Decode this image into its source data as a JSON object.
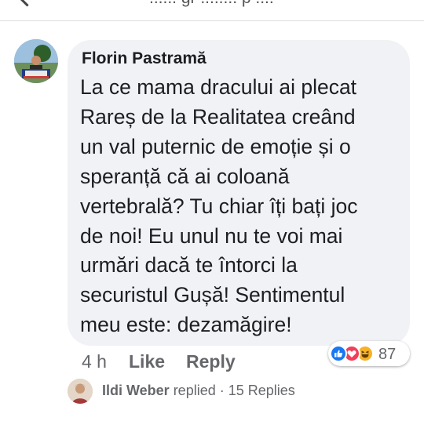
{
  "header": {
    "truncated_text": "...... gr ........ p ...."
  },
  "comment": {
    "author": "Florin Pastramă",
    "text_lines": [
      "La ce mama dracului ai plecat",
      "Rareș de la Realitatea creând",
      "un val puternic de emoție și o",
      "speranță că ai coloană",
      "vertebrală? Tu chiar îți bați joc",
      "de noi! Eu unul nu te voi mai",
      "urmări dacă te întorci la",
      "securistul Gușă! Sentimentul",
      "meu este: dezamăgire!"
    ],
    "time": "4 h",
    "like_label": "Like",
    "reply_label": "Reply",
    "reactions": {
      "icons": [
        "like-icon",
        "love-icon",
        "haha-icon"
      ],
      "count": "87"
    }
  },
  "replies": {
    "replier_name": "Ildi Weber",
    "replied_text": " replied · 15 Replies"
  },
  "colors": {
    "bubble": "#f0f2f5",
    "text": "#1c1e21",
    "secondary": "#65676b",
    "like_blue": "#1877f2",
    "love_red": "#f33e58",
    "haha_yellow": "#f7b125"
  }
}
